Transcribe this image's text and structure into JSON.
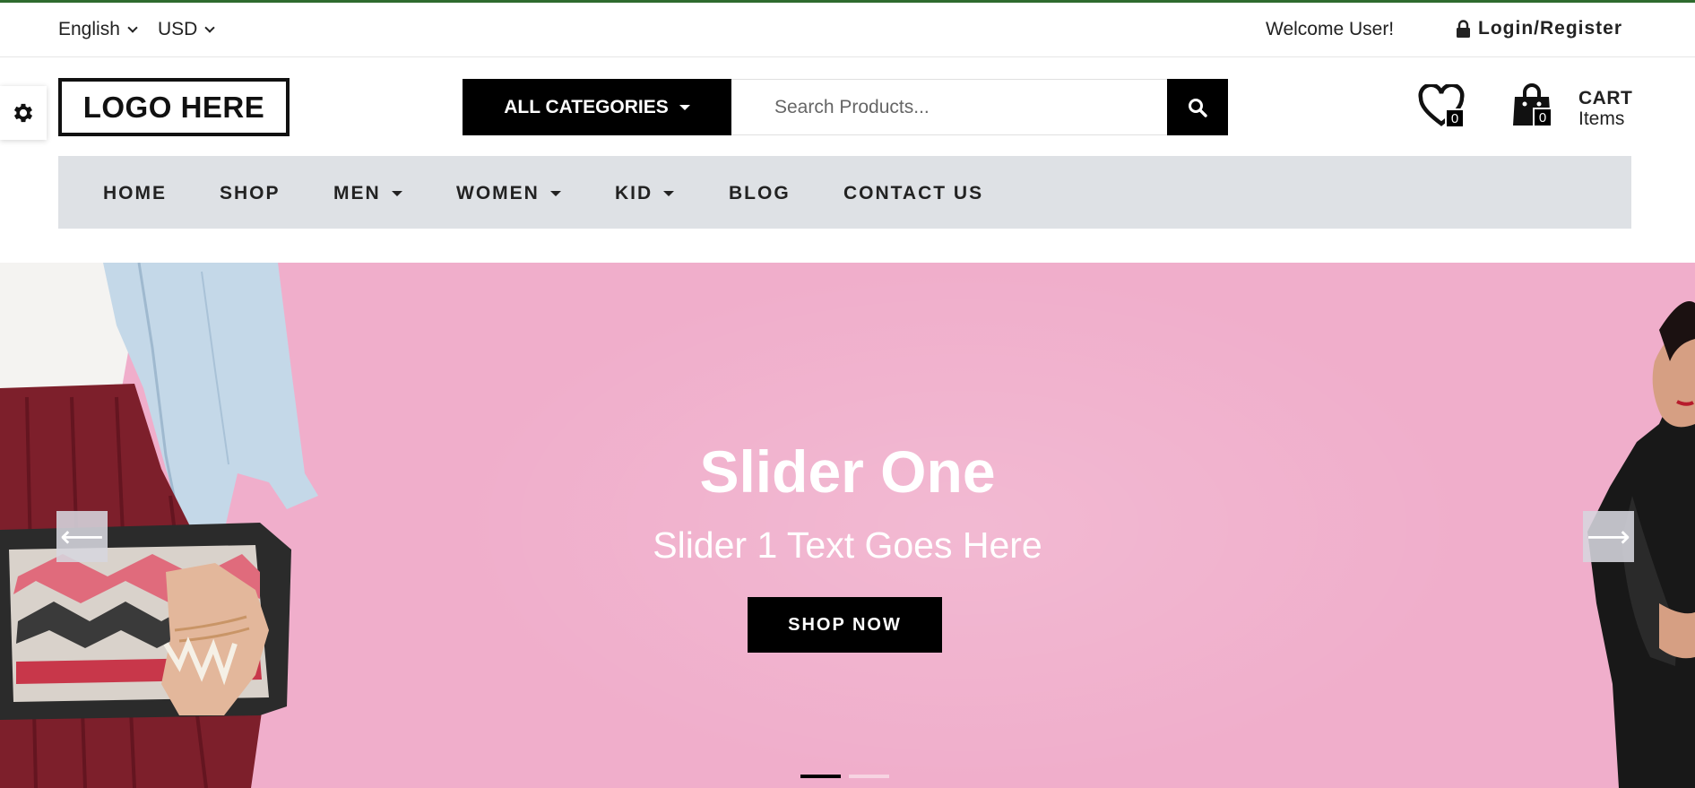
{
  "topbar": {
    "language": "English",
    "currency": "USD",
    "welcome": "Welcome User!",
    "login": "Login/Register"
  },
  "header": {
    "logo": "LOGO HERE",
    "categories_label": "ALL CATEGORIES",
    "search_placeholder": "Search Products...",
    "wishlist_count": "0",
    "cart_count": "0",
    "cart_title": "CART",
    "cart_subtitle": "Items"
  },
  "nav": {
    "items": [
      {
        "label": "HOME"
      },
      {
        "label": "SHOP"
      },
      {
        "label": "MEN"
      },
      {
        "label": "WOMEN"
      },
      {
        "label": "KID"
      },
      {
        "label": "BLOG"
      },
      {
        "label": "CONTACT US"
      }
    ]
  },
  "slider": {
    "title": "Slider One",
    "subtitle": "Slider 1 Text Goes Here",
    "button": "SHOP NOW",
    "prev_arrow": "⟵",
    "next_arrow": "⟶",
    "slide_count": 2,
    "active_slide": 1
  },
  "colors": {
    "accent_line": "#2e6b2e",
    "hero_background": "#f0aecb",
    "nav_background": "#dee1e5",
    "button_background": "#000000"
  }
}
